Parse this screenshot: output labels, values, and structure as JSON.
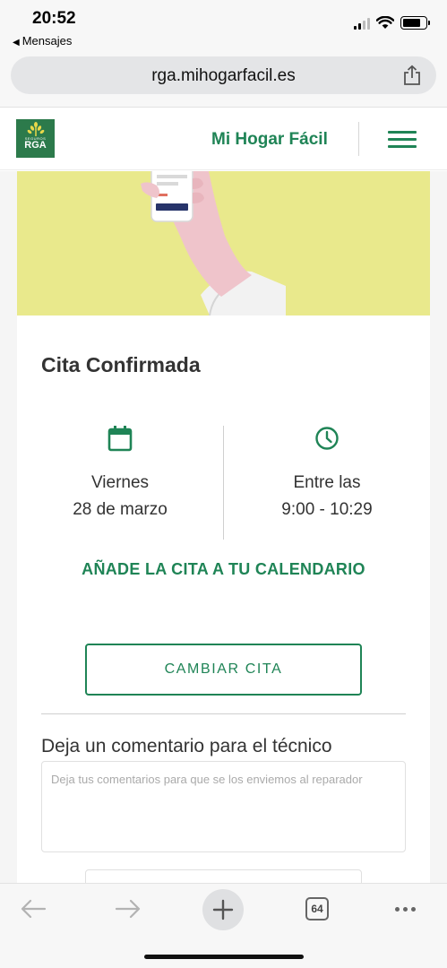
{
  "status_bar": {
    "time": "20:52",
    "back_app": "Mensajes"
  },
  "browser": {
    "url": "rga.mihogarfacil.es",
    "tab_count": "64"
  },
  "header": {
    "logo_small_text": "SEGUROS",
    "logo_text": "RGA",
    "brand_name": "Mi Hogar Fácil"
  },
  "appointment": {
    "title": "Cita Confirmada",
    "day_label": "Viernes",
    "date": "28 de marzo",
    "time_label": "Entre las",
    "time_range": "9:00 - 10:29",
    "add_calendar": "AÑADE LA CITA A TU CALENDARIO",
    "change_button": "CAMBIAR CITA"
  },
  "comment": {
    "title": "Deja un comentario para el técnico",
    "placeholder": "Deja tus comentarios para que se los enviemos al reparador"
  },
  "colors": {
    "brand_green": "#1f8456",
    "hero_yellow": "#e9e98c",
    "logo_green": "#2c7a4b"
  }
}
